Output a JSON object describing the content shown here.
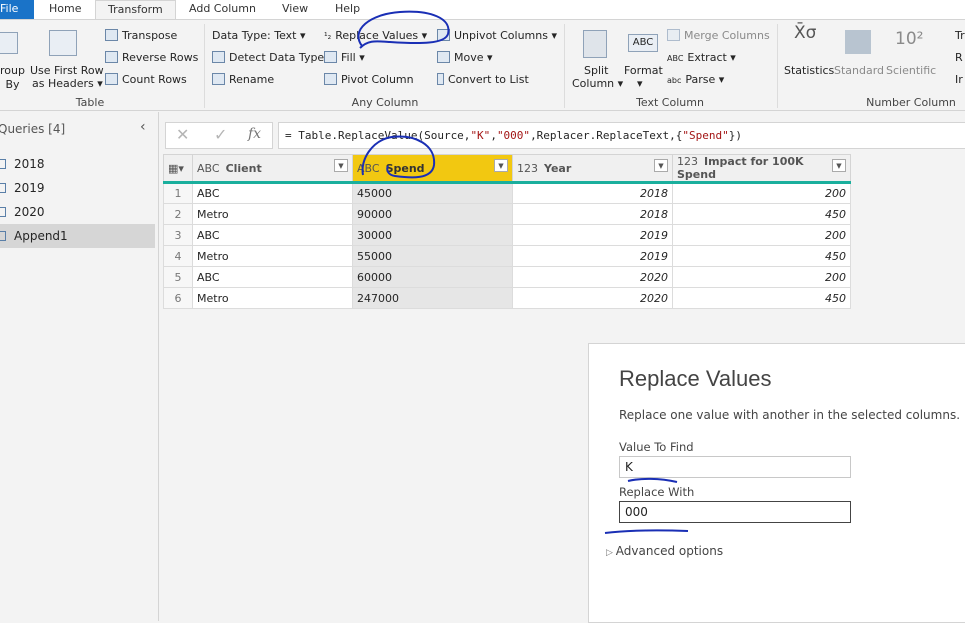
{
  "tabs": [
    {
      "label": "File"
    },
    {
      "label": "Home"
    },
    {
      "label": "Transform"
    },
    {
      "label": "Add Column"
    },
    {
      "label": "View"
    },
    {
      "label": "Help"
    }
  ],
  "ribbon": {
    "table": {
      "group_label": "Table",
      "group_by": "roup\nBy",
      "use_first_row": "Use First Row",
      "as_headers": "as Headers ▾",
      "transpose": "Transpose",
      "reverse_rows": "Reverse Rows",
      "count_rows": "Count Rows"
    },
    "any_column": {
      "group_label": "Any Column",
      "data_type": "Data Type: Text ▾",
      "detect_data_type": "Detect Data Type",
      "rename": "Rename",
      "replace_values": "Replace Values ▾",
      "fill": "Fill ▾",
      "pivot_column": "Pivot Column",
      "unpivot_columns": "Unpivot Columns ▾",
      "move": "Move ▾",
      "convert_to_list": "Convert to List"
    },
    "text_column": {
      "group_label": "Text Column",
      "split_column": "Split",
      "split_column2": "Column ▾",
      "format": "Format",
      "format2": "▾",
      "merge_columns": "Merge Columns",
      "extract": "Extract ▾",
      "parse": "Parse ▾"
    },
    "number_column": {
      "group_label": "Number Column",
      "statistics": "Statistics",
      "standard": "Standard",
      "scientific": "Scientific",
      "trig": "Tr",
      "rounding": "R",
      "info": "Ir"
    }
  },
  "queries": {
    "title": "Queries [4]",
    "items": [
      {
        "label": "2018"
      },
      {
        "label": "2019"
      },
      {
        "label": "2020"
      },
      {
        "label": "Append1",
        "selected": true
      }
    ]
  },
  "formula": {
    "prefix": "= Table.ReplaceValue(Source,",
    "a1": "\"K\"",
    "c1": ",",
    "a2": "\"000\"",
    "c2": ",Replacer.ReplaceText,{",
    "a3": "\"Spend\"",
    "c3": "})"
  },
  "table": {
    "columns": [
      {
        "type": "ABC",
        "name": "Client"
      },
      {
        "type": "ABC",
        "name": "Spend",
        "selected": true
      },
      {
        "type": "123",
        "name": "Year"
      },
      {
        "type": "123",
        "name": "Impact for 100K Spend"
      }
    ],
    "rows": [
      [
        "1",
        "ABC",
        "45000",
        "2018",
        "200"
      ],
      [
        "2",
        "Metro",
        "90000",
        "2018",
        "450"
      ],
      [
        "3",
        "ABC",
        "30000",
        "2019",
        "200"
      ],
      [
        "4",
        "Metro",
        "55000",
        "2019",
        "450"
      ],
      [
        "5",
        "ABC",
        "60000",
        "2020",
        "200"
      ],
      [
        "6",
        "Metro",
        "247000",
        "2020",
        "450"
      ]
    ]
  },
  "dialog": {
    "title": "Replace Values",
    "subtitle": "Replace one value with another in the selected columns.",
    "find_label": "Value To Find",
    "find_value": "K",
    "replace_label": "Replace With",
    "replace_value": "000",
    "advanced": "Advanced options"
  },
  "colors": {
    "accent": "#f2c811",
    "teal": "#1aaf9d",
    "file_tab": "#1a73c8",
    "annotation_ink": "#1a2fb5"
  }
}
